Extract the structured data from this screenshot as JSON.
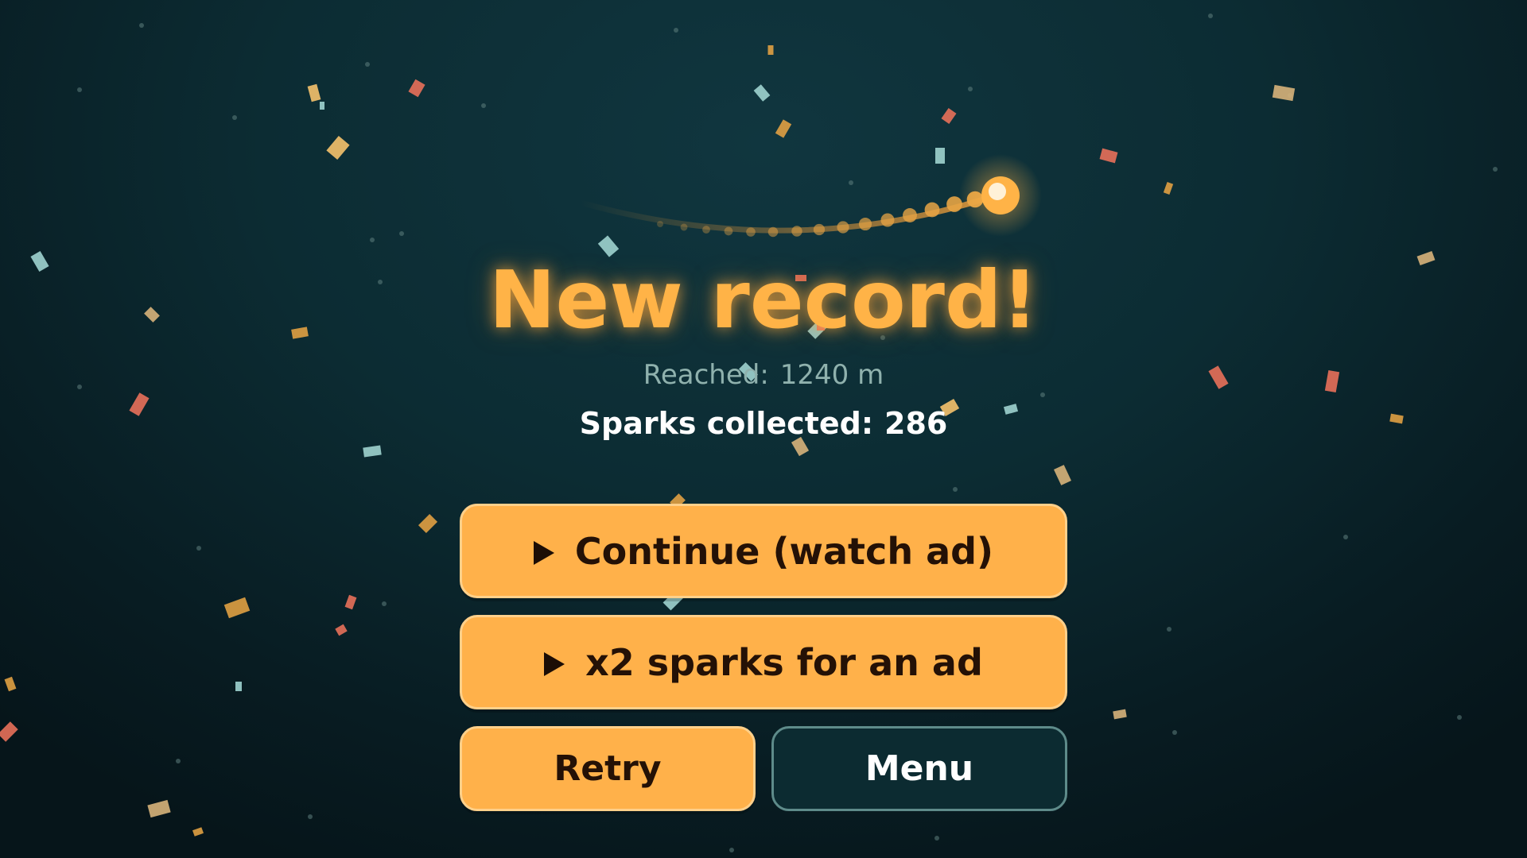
{
  "screen": "game-over",
  "title": "New record!",
  "stats": {
    "reached_label": "Reached:",
    "reached_value": "1240 m",
    "sparks_label": "Sparks collected:",
    "sparks_value": "286"
  },
  "buttons": {
    "continue": {
      "icon": "play-icon",
      "label": "Continue (watch ad)"
    },
    "double": {
      "icon": "play-icon",
      "label": "x2 sparks for an ad"
    },
    "retry": {
      "label": "Retry"
    },
    "menu": {
      "label": "Menu"
    }
  },
  "colors": {
    "accent": "#ffb14a",
    "title": "#ffb347",
    "background": "#0c2c33",
    "secondary_border": "#5e8b8a",
    "confetti": [
      "#f5c26b",
      "#e8705a",
      "#9fd3cf",
      "#e0a042",
      "#d7b27a"
    ]
  }
}
